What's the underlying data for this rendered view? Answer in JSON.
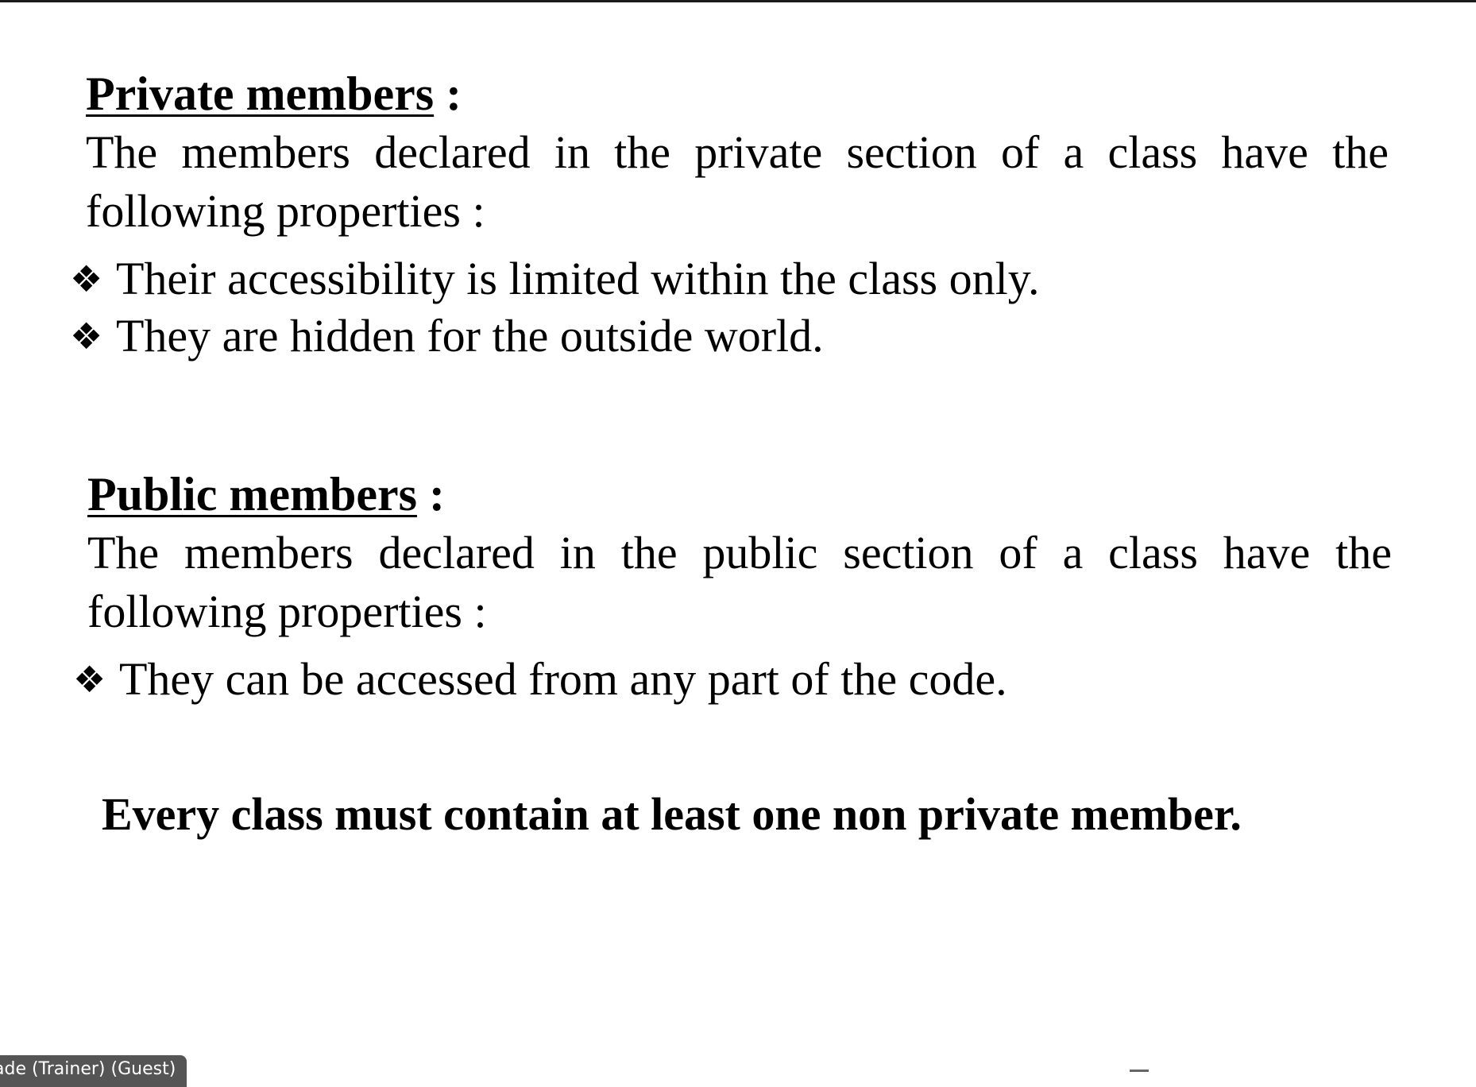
{
  "private_section": {
    "heading": "Private members",
    "heading_suffix": " :",
    "description": "The members declared in the private section of a class have the following properties :",
    "bullets": [
      "Their accessibility is limited within the class only.",
      "They are hidden for the outside world."
    ]
  },
  "public_section": {
    "heading": "Public members",
    "heading_suffix": " :",
    "description": "The members declared in the public section of a class have the following properties :",
    "bullets": [
      "They can be accessed from any part of the code."
    ]
  },
  "note": "Every class must contain at least one non private member.",
  "bullet_glyph": "❖",
  "presenter_label": "ade (Trainer) (Guest)",
  "colors": {
    "background": "#ffffff",
    "text": "#000000",
    "presenter_tag": "#555555"
  }
}
